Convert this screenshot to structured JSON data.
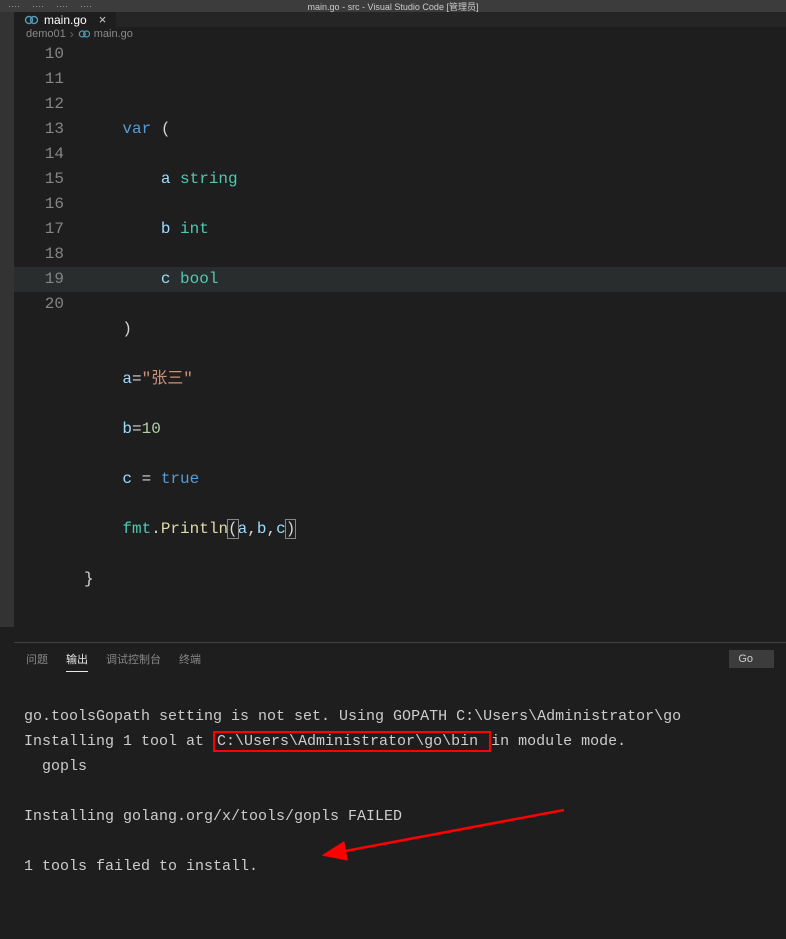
{
  "window": {
    "title": "main.go - src - Visual Studio Code [管理员]"
  },
  "tab": {
    "filename": "main.go"
  },
  "breadcrumb": {
    "folder": "demo01",
    "file": "main.go"
  },
  "lineNumbers": [
    "10",
    "11",
    "12",
    "13",
    "14",
    "15",
    "16",
    "17",
    "18",
    "19",
    "20"
  ],
  "code": {
    "l11_kw": "var",
    "l11_paren": " (",
    "l12_id": "a",
    "l12_typ": " string",
    "l13_id": "b",
    "l13_typ": " int",
    "l14_id": "c",
    "l14_typ": " bool",
    "l15_paren": ")",
    "l16_id": "a",
    "l16_eq": "=",
    "l16_str": "\"张三\"",
    "l17_id": "b",
    "l17_eq": "=",
    "l17_num": "10",
    "l18_id": "c",
    "l18_eq": " = ",
    "l18_bool": "true",
    "l19_pkg": "fmt",
    "l19_dot": ".",
    "l19_fn": "Println",
    "l19_open": "(",
    "l19_args_a": "a",
    "l19_c1": ",",
    "l19_args_b": "b",
    "l19_c2": ",",
    "l19_args_c": "c",
    "l19_close": ")",
    "l20_brace": "}"
  },
  "panel": {
    "tabs": {
      "problems": "问题",
      "output": "输出",
      "debug": "调试控制台",
      "terminal": "终端"
    },
    "selector": "Go"
  },
  "output": {
    "line1a": "go.toolsGopath setting is not set. Using GOPATH C:\\Users\\Administrator\\go",
    "line2a": "Installing 1 tool at ",
    "line2_boxed": "C:\\Users\\Administrator\\go\\bin ",
    "line2b": "in module mode.",
    "line3": "  gopls",
    "line4": "",
    "line5": "Installing golang.org/x/tools/gopls FAILED",
    "line6": "",
    "line7": "1 tools failed to install."
  }
}
